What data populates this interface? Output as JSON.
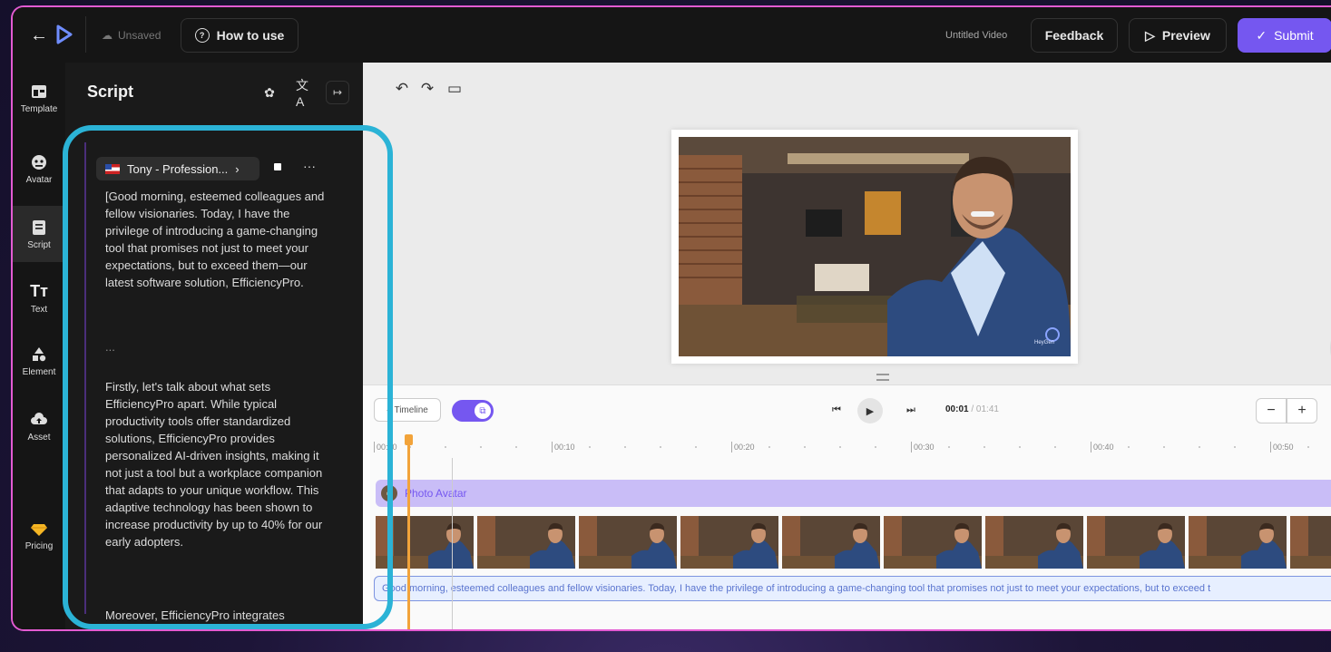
{
  "topbar": {
    "back_icon": "arrow-left-icon",
    "unsaved_label": "Unsaved",
    "how_to_use_label": "How to use",
    "video_title": "Untitled Video",
    "feedback_label": "Feedback",
    "preview_label": "Preview",
    "submit_label": "Submit",
    "accent_color": "#7557f0"
  },
  "leftnav": {
    "items": [
      {
        "label": "Template",
        "icon": "template-icon"
      },
      {
        "label": "Avatar",
        "icon": "avatar-icon"
      },
      {
        "label": "Script",
        "icon": "script-icon",
        "active": true
      },
      {
        "label": "Text",
        "icon": "text-icon"
      },
      {
        "label": "Element",
        "icon": "element-icon"
      },
      {
        "label": "Asset",
        "icon": "asset-icon"
      },
      {
        "label": "Pricing",
        "icon": "diamond-icon"
      }
    ]
  },
  "script_panel": {
    "title": "Script",
    "voice_name": "Tony - Profession...",
    "voice_more": "···",
    "paragraphs": [
      "[Good morning, esteemed colleagues and fellow visionaries. Today, I have the privilege of introducing a game-changing tool that promises not just to meet your expectations, but to exceed them—our latest software solution, EfficiencyPro.",
      "...",
      "Firstly, let's talk about what sets EfficiencyPro apart. While typical productivity tools offer standardized solutions, EfficiencyPro provides personalized AI-driven insights, making it not just a tool but a workplace companion that adapts to your unique workflow. This adaptive technology has been shown to increase productivity by up to 40% for our early adopters.",
      "Moreover, EfficiencyPro integrates"
    ],
    "highlight_color": "#2bb3d6"
  },
  "canvas": {
    "watermark": "HeyGen"
  },
  "timeline": {
    "toggle_label": "Timeline",
    "toggle_on": true,
    "current_time": "00:01",
    "duration": "/ 01:41",
    "zoom_out": "−",
    "zoom_in": "+",
    "ruler_marks": [
      "00:00",
      "00:10",
      "00:20",
      "00:30",
      "00:40",
      "00:50"
    ],
    "avatar_track_label": "Photo Avatar",
    "script_track_text": "Good morning, esteemed colleagues and fellow visionaries. Today, I have the privilege of introducing a game-changing tool that promises not just to meet your expectations, but to exceed t",
    "playhead_color": "#f2a33a"
  }
}
